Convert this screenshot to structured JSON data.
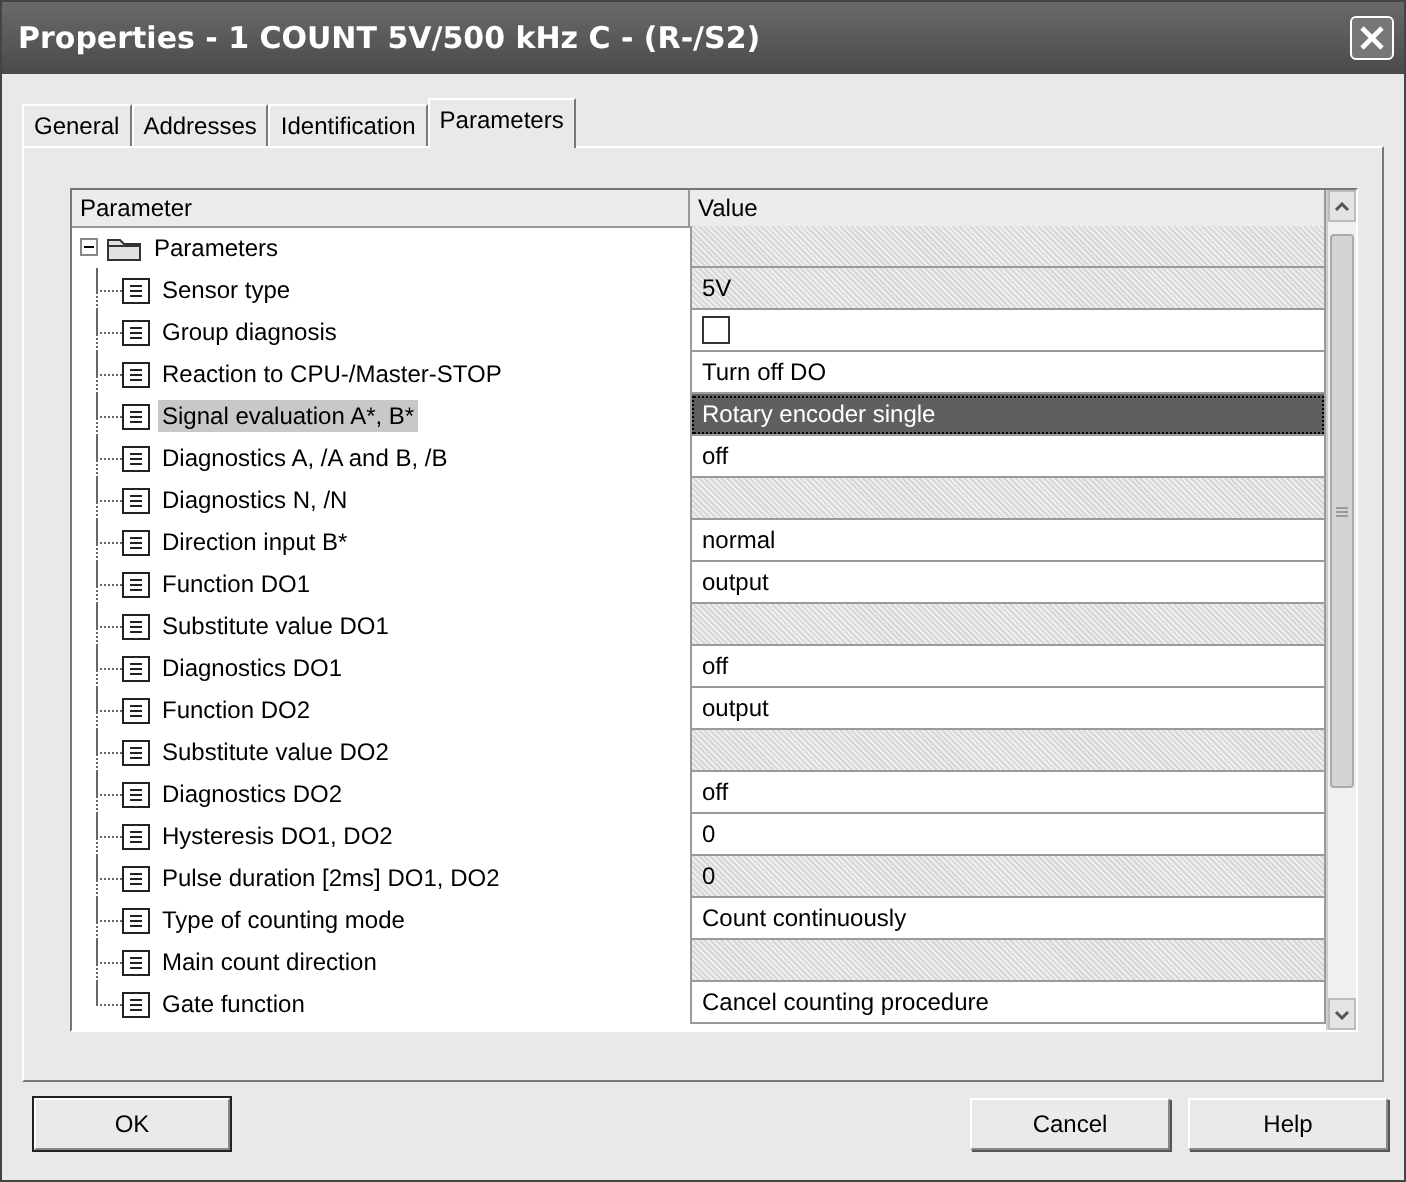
{
  "window": {
    "title": "Properties - 1 COUNT 5V/500 kHz C - (R-/S2)"
  },
  "tabs": [
    {
      "label": "General",
      "selected": false
    },
    {
      "label": "Addresses",
      "selected": false
    },
    {
      "label": "Identification",
      "selected": false
    },
    {
      "label": "Parameters",
      "selected": true
    }
  ],
  "table": {
    "columns": [
      "Parameter",
      "Value"
    ],
    "tree": {
      "label": "Parameters",
      "expanded": true,
      "children": [
        {
          "label": "Sensor type",
          "kind": "text",
          "value": "5V",
          "editable": false,
          "selected": false
        },
        {
          "label": "Group diagnosis",
          "kind": "checkbox",
          "checked": false,
          "editable": true,
          "selected": false
        },
        {
          "label": "Reaction to CPU-/Master-STOP",
          "kind": "text",
          "value": "Turn off DO",
          "editable": true,
          "selected": false
        },
        {
          "label": "Signal evaluation A*, B*",
          "kind": "text",
          "value": "Rotary encoder single",
          "editable": true,
          "selected": true
        },
        {
          "label": "Diagnostics A, /A and B, /B",
          "kind": "text",
          "value": "off",
          "editable": true,
          "selected": false
        },
        {
          "label": "Diagnostics N, /N",
          "kind": "text",
          "editable": false,
          "selected": false
        },
        {
          "label": "Direction input B*",
          "kind": "text",
          "value": "normal",
          "editable": true,
          "selected": false
        },
        {
          "label": "Function DO1",
          "kind": "text",
          "value": "output",
          "editable": true,
          "selected": false
        },
        {
          "label": "Substitute value DO1",
          "kind": "text",
          "editable": false,
          "selected": false
        },
        {
          "label": "Diagnostics DO1",
          "kind": "text",
          "value": "off",
          "editable": true,
          "selected": false
        },
        {
          "label": "Function DO2",
          "kind": "text",
          "value": "output",
          "editable": true,
          "selected": false
        },
        {
          "label": "Substitute value DO2",
          "kind": "text",
          "editable": false,
          "selected": false
        },
        {
          "label": "Diagnostics DO2",
          "kind": "text",
          "value": "off",
          "editable": true,
          "selected": false
        },
        {
          "label": "Hysteresis DO1, DO2",
          "kind": "text",
          "value": "0",
          "editable": true,
          "selected": false
        },
        {
          "label": "Pulse duration [2ms] DO1, DO2",
          "kind": "text",
          "value": "0",
          "editable": false,
          "selected": false
        },
        {
          "label": "Type of counting mode",
          "kind": "text",
          "value": "Count continuously",
          "editable": true,
          "selected": false
        },
        {
          "label": "Main count direction",
          "kind": "text",
          "editable": false,
          "selected": false
        },
        {
          "label": "Gate function",
          "kind": "text",
          "value": "Cancel counting procedure",
          "editable": true,
          "selected": false
        }
      ]
    }
  },
  "buttons": [
    {
      "label": "OK",
      "kind": "default"
    },
    {
      "label": "Cancel",
      "kind": "normal"
    },
    {
      "label": "Help",
      "kind": "normal"
    }
  ]
}
